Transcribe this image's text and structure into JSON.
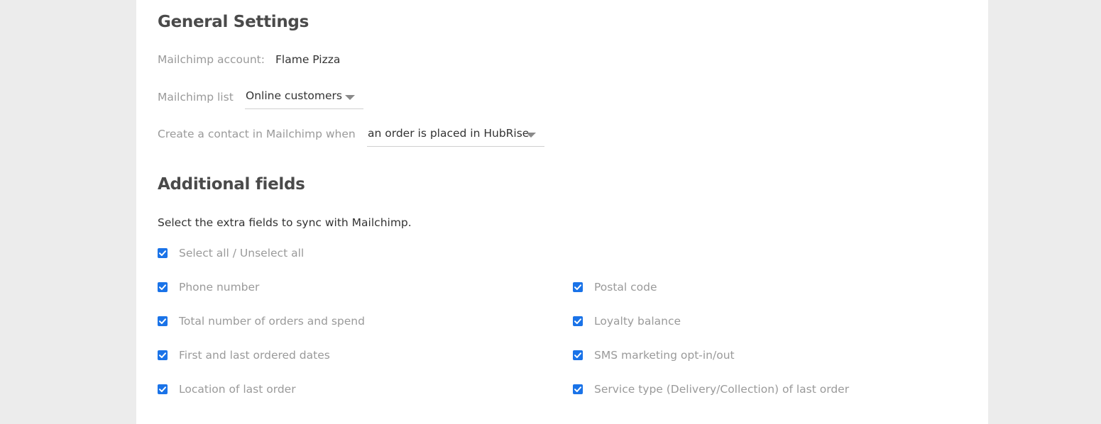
{
  "general": {
    "title": "General Settings",
    "account_label": "Mailchimp account:",
    "account_value": "Flame Pizza",
    "list_label": "Mailchimp list",
    "list_value": "Online customers",
    "create_label": "Create a contact in Mailchimp when",
    "create_value": "an order is placed in HubRise"
  },
  "additional": {
    "title": "Additional fields",
    "description": "Select the extra fields to sync with Mailchimp.",
    "select_all": {
      "label": "Select all / Unselect all",
      "checked": true
    },
    "fields": [
      {
        "label": "Phone number",
        "checked": true
      },
      {
        "label": "Postal code",
        "checked": true
      },
      {
        "label": "Total number of orders and spend",
        "checked": true
      },
      {
        "label": "Loyalty balance",
        "checked": true
      },
      {
        "label": "First and last ordered dates",
        "checked": true
      },
      {
        "label": "SMS marketing opt-in/out",
        "checked": true
      },
      {
        "label": "Location of last order",
        "checked": true
      },
      {
        "label": "Service type (Delivery/Collection) of last order",
        "checked": true
      }
    ]
  },
  "colors": {
    "page_bg": "#ececec",
    "panel_bg": "#ffffff",
    "checkbox_accent": "#1a73e8",
    "heading": "#4a4a4a",
    "muted_label": "#9a9a9a",
    "value_text": "#333333"
  },
  "icons": {
    "checkbox": "checkmark-icon",
    "dropdown": "caret-down-icon"
  }
}
